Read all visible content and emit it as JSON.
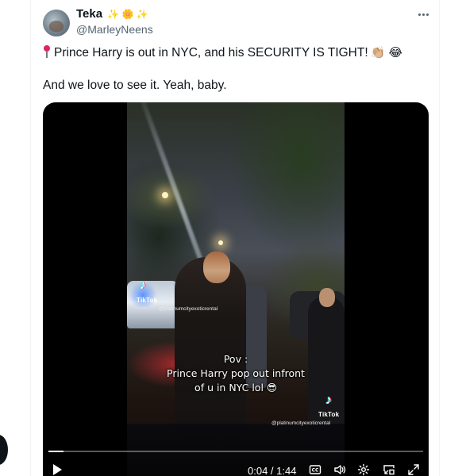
{
  "tweet": {
    "display_name": "Teka",
    "name_emojis": "✨ 🌼 ✨",
    "handle": "@MarleyNeens",
    "line1": "Prince Harry is out in NYC, and his SECURITY IS TIGHT!",
    "line1_emojis": "👏🏼 😂",
    "line2": "And we love to see it. Yeah, baby."
  },
  "video": {
    "watermark_top": {
      "brand": "TikTok",
      "username": "@platinumcityexoticrental"
    },
    "watermark_bottom": {
      "brand": "TikTok",
      "username": "@platinumcityexoticrental"
    },
    "caption_line1": "Pov :",
    "caption_line2": "Prince Harry pop out infront",
    "caption_line3": "of u in NYC lol 😎",
    "time": "0:04 / 1:44",
    "progress": 0.04
  },
  "icons": {
    "more": "more-horizontal-icon",
    "play": "play-icon",
    "captions": "closed-captions-icon",
    "volume": "volume-icon",
    "settings": "settings-gear-icon",
    "pip": "picture-in-picture-icon",
    "fullscreen": "fullscreen-icon"
  }
}
